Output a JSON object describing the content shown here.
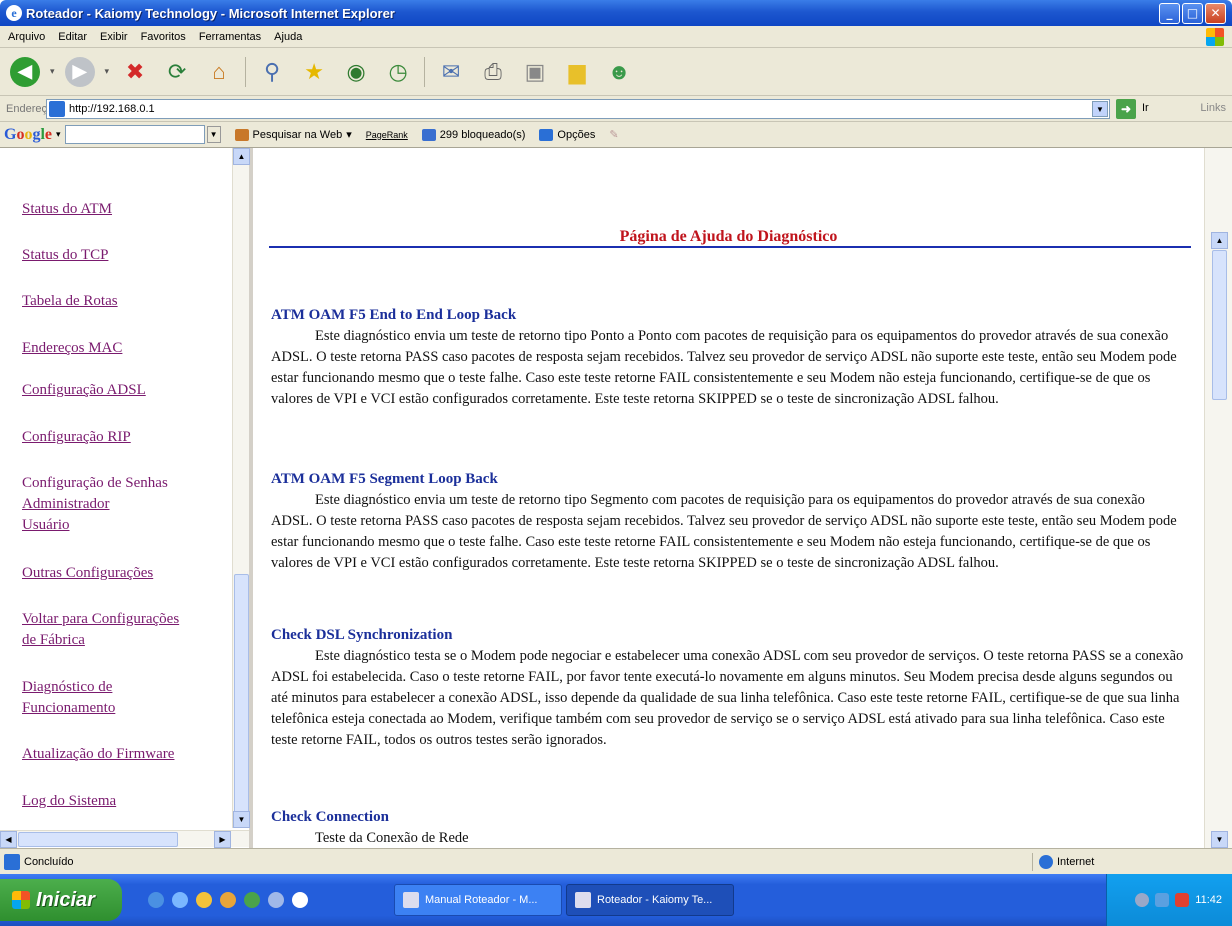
{
  "window": {
    "title": "Roteador - Kaiomy Technology - Microsoft Internet Explorer"
  },
  "menu": {
    "items": [
      "Arquivo",
      "Editar",
      "Exibir",
      "Favoritos",
      "Ferramentas",
      "Ajuda"
    ]
  },
  "toolbar": {
    "icons": [
      "back-icon",
      "forward-icon",
      "stop-icon",
      "refresh-icon",
      "home-icon",
      "search-icon",
      "favorites-icon",
      "media-icon",
      "history-icon",
      "mail-icon",
      "print-icon",
      "edit-icon",
      "folder-icon",
      "messenger-icon"
    ]
  },
  "address": {
    "label": "Endereço",
    "url": "http://192.168.0.1",
    "go_label": "Ir",
    "links_label": "Links"
  },
  "google_bar": {
    "logo": "Google",
    "search_web": "Pesquisar na Web",
    "pagerank": "PageRank",
    "blocked": "299 bloqueado(s)",
    "options": "Opções"
  },
  "sidebar": {
    "items": [
      {
        "label": "Status do ATM"
      },
      {
        "label": "Status do TCP"
      },
      {
        "label": "Tabela de Rotas"
      },
      {
        "label": "Endereços MAC"
      },
      {
        "label": "Configuração ADSL"
      },
      {
        "label": "Configuração RIP"
      },
      {
        "label": "Configuração de Senhas"
      },
      {
        "label": "Administrador"
      },
      {
        "label": "Usuário"
      },
      {
        "label": "Outras Configurações"
      },
      {
        "label": "Voltar para Configurações"
      },
      {
        "label": "de Fábrica"
      },
      {
        "label": "Diagnóstico de"
      },
      {
        "label": "Funcionamento"
      },
      {
        "label": "Atualização do Firmware"
      },
      {
        "label": "Log do Sistema"
      }
    ]
  },
  "page": {
    "title": "Página de Ajuda do Diagnóstico",
    "sections": [
      {
        "heading": "ATM OAM F5 End to End Loop Back",
        "body": "Este diagnóstico envia um teste de retorno tipo Ponto a Ponto com pacotes de requisição para os equipamentos do provedor através de sua conexão ADSL. O teste retorna PASS caso pacotes de resposta sejam recebidos. Talvez seu provedor de serviço ADSL não suporte este teste, então seu Modem pode estar funcionando mesmo que o teste falhe. Caso este teste retorne FAIL consistentemente e seu Modem não esteja funcionando, certifique-se de que os valores de VPI e VCI estão configurados corretamente. Este teste retorna SKIPPED se o teste de sincronização ADSL falhou."
      },
      {
        "heading": "ATM OAM F5 Segment Loop Back",
        "body": "Este diagnóstico envia um teste de retorno tipo Segmento com pacotes de requisição para os equipamentos do provedor através de sua  conexão ADSL. O teste retorna PASS caso pacotes de resposta sejam recebidos. Talvez seu provedor de serviço ADSL não suporte este teste, então seu Modem pode estar funcionando mesmo que o teste falhe. Caso este teste retorne FAIL consistentemente e seu Modem não esteja funcionando, certifique-se de que os valores de VPI e VCI estão configurados corretamente. Este teste retorna SKIPPED se o teste de sincronização ADSL falhou."
      },
      {
        "heading": "Check DSL Synchronization",
        "body": "Este diagnóstico testa se o Modem pode negociar e estabelecer uma conexão ADSL com seu provedor de serviços. O teste retorna PASS se a conexão ADSL foi estabelecida. Caso o teste retorne FAIL, por favor tente executá-lo novamente em alguns minutos. Seu Modem precisa desde alguns segundos ou até minutos para estabelecer a conexão ADSL, isso depende da qualidade de sua linha telefônica. Caso este teste retorne FAIL, certifique-se de que sua linha telefônica esteja conectada ao Modem, verifique também com seu provedor de serviço se o serviço ADSL está ativado para sua linha telefônica. Caso este teste retorne FAIL, todos os outros testes serão ignorados."
      },
      {
        "heading": "Check Connection",
        "body": "Teste da Conexão de Rede"
      }
    ]
  },
  "status": {
    "text": "Concluído",
    "zone": "Internet"
  },
  "taskbar": {
    "start": "Iniciar",
    "tasks": [
      "Manual Roteador - M...",
      "Roteador - Kaiomy Te..."
    ],
    "clock": "11:42"
  },
  "colors": {
    "link": "#7a1a6e",
    "heading": "#1b2f9a",
    "page_title": "#c0141c",
    "rule": "#1b2fb0"
  }
}
